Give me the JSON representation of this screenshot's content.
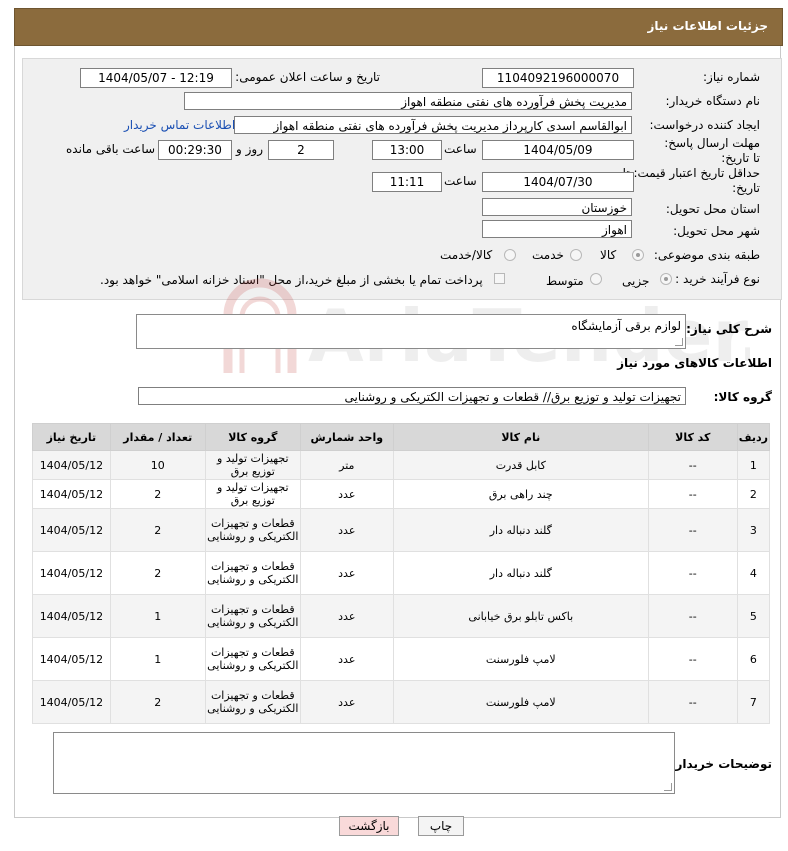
{
  "header": {
    "title": "جزئیات اطلاعات نیاز"
  },
  "form": {
    "need_number_label": "شماره نیاز:",
    "need_number": "1104092196000070",
    "announce_label": "تاریخ و ساعت اعلان عمومی:",
    "announce_value": "1404/05/07 - 12:19",
    "buyer_org_label": "نام دستگاه خریدار:",
    "buyer_org": "مدیریت پخش فرآورده های نفتی منطقه اهواز",
    "creator_label": "ایجاد کننده درخواست:",
    "creator": "ابوالقاسم اسدی کارپرداز مدیریت پخش فرآورده های نفتی منطقه اهواز",
    "contact_link": "اطلاعات تماس خریدار",
    "reply_deadline_label": "مهلت ارسال پاسخ: تا تاریخ:",
    "reply_date": "1404/05/09",
    "time_label": "ساعت",
    "reply_time": "13:00",
    "days_value": "2",
    "days_label": "روز و",
    "remaining_time": "00:29:30",
    "remaining_label": "ساعت باقی مانده",
    "price_deadline_label": "حداقل تاریخ اعتبار قیمت: تا تاریخ:",
    "price_date": "1404/07/30",
    "price_time": "11:11",
    "province_label": "استان محل تحویل:",
    "province": "خوزستان",
    "city_label": "شهر محل تحویل:",
    "city": "اهواز",
    "category_label": "طبقه بندی موضوعی:",
    "category_options": [
      "کالا",
      "خدمت",
      "کالا/خدمت"
    ],
    "process_label": "نوع فرآیند خرید :",
    "process_options": [
      "جزیی",
      "متوسط"
    ],
    "payment_note": "پرداخت تمام یا بخشی از مبلغ خرید،از محل \"اسناد خزانه اسلامی\" خواهد بود."
  },
  "description": {
    "label": "شرح کلی نیاز:",
    "value": "لوازم برقی آزمایشگاه"
  },
  "goods": {
    "section_title": "اطلاعات کالاهای مورد نیاز",
    "group_label": "گروه کالا:",
    "group_value": "تجهیزات تولید و توزیع برق// قطعات و تجهیزات الکتریکی و روشنایی",
    "columns": [
      "ردیف",
      "کد کالا",
      "نام کالا",
      "واحد شمارش",
      "گروه کالا",
      "تعداد / مقدار",
      "تاریخ نیاز"
    ],
    "rows": [
      [
        "1",
        "--",
        "کابل قدرت",
        "متر",
        "تجهیزات تولید و توزیع برق",
        "10",
        "1404/05/12"
      ],
      [
        "2",
        "--",
        "چند راهی برق",
        "عدد",
        "تجهیزات تولید و توزیع برق",
        "2",
        "1404/05/12"
      ],
      [
        "3",
        "--",
        "گلند دنباله دار",
        "عدد",
        "قطعات و تجهیزات الکتریکی و روشنایی",
        "2",
        "1404/05/12"
      ],
      [
        "4",
        "--",
        "گلند دنباله دار",
        "عدد",
        "قطعات و تجهیزات الکتریکی و روشنایی",
        "2",
        "1404/05/12"
      ],
      [
        "5",
        "--",
        "باکس تابلو برق خیابانی",
        "عدد",
        "قطعات و تجهیزات الکتریکی و روشنایی",
        "1",
        "1404/05/12"
      ],
      [
        "6",
        "--",
        "لامپ فلورسنت",
        "عدد",
        "قطعات و تجهیزات الکتریکی و روشنایی",
        "1",
        "1404/05/12"
      ],
      [
        "7",
        "--",
        "لامپ فلورسنت",
        "عدد",
        "قطعات و تجهیزات الکتریکی و روشنایی",
        "2",
        "1404/05/12"
      ]
    ]
  },
  "buyer_notes": {
    "label": "توضیحات خریدار:",
    "value": ""
  },
  "buttons": {
    "print": "چاپ",
    "back": "بازگشت"
  },
  "watermark": {
    "text": "AriaTender.neT"
  },
  "colors": {
    "title_bg": "#8b6b3d",
    "link": "#1a4fb3",
    "back_btn_bg": "#f9d9d9"
  }
}
